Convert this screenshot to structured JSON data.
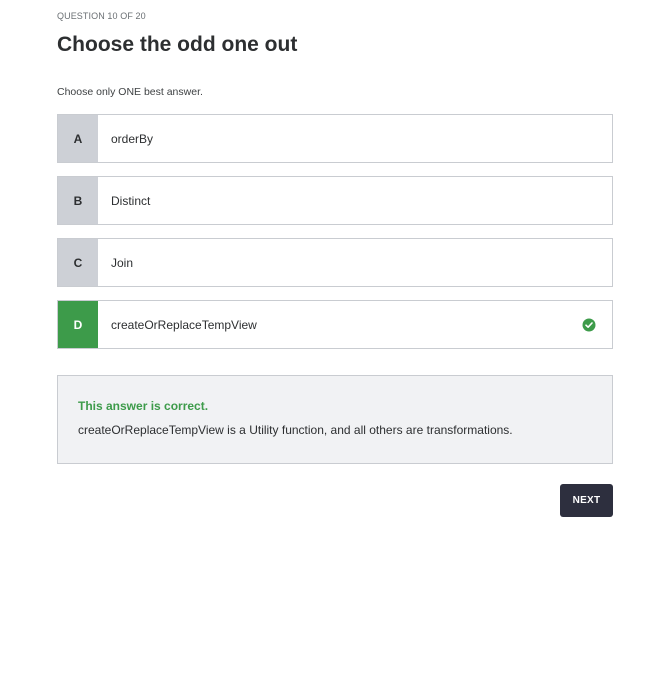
{
  "question": {
    "counter": "QUESTION 10 OF 20",
    "title": "Choose the odd one out",
    "instructions": "Choose only ONE best answer."
  },
  "options": [
    {
      "letter": "A",
      "text": "orderBy",
      "selected": false
    },
    {
      "letter": "B",
      "text": "Distinct",
      "selected": false
    },
    {
      "letter": "C",
      "text": "Join",
      "selected": false
    },
    {
      "letter": "D",
      "text": "createOrReplaceTempView",
      "selected": true,
      "icon": "check-circle-icon"
    }
  ],
  "feedback": {
    "title": "This answer is correct.",
    "text": "createOrReplaceTempView is a Utility function, and all others are transformations."
  },
  "actions": {
    "next_label": "NEXT"
  },
  "colors": {
    "correct": "#3d9b4a",
    "button": "#2d2f3e",
    "letter_bg": "#cdd0d6",
    "feedback_bg": "#f1f2f4"
  }
}
